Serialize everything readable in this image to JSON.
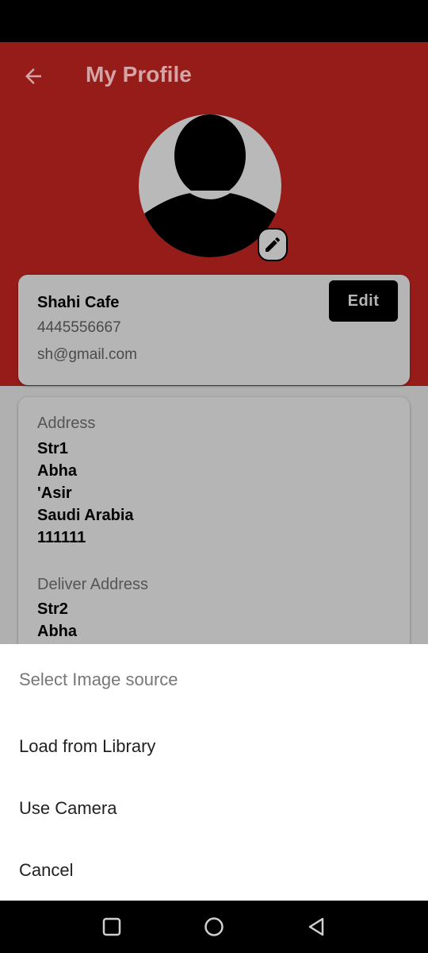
{
  "header": {
    "title": "My Profile"
  },
  "profile": {
    "name": "Shahi Cafe",
    "phone": "4445556667",
    "email": "sh@gmail.com",
    "edit_label": "Edit"
  },
  "address": {
    "label": "Address",
    "lines": [
      "Str1",
      "Abha",
      "'Asir",
      "Saudi Arabia",
      "111111"
    ]
  },
  "delivery": {
    "label": "Deliver Address",
    "lines": [
      "Str2",
      "Abha"
    ]
  },
  "sheet": {
    "title": "Select Image source",
    "options": [
      "Load from Library",
      "Use Camera",
      "Cancel"
    ]
  },
  "colors": {
    "brand": "#961c1a",
    "scrim": "#b0b0b0"
  }
}
